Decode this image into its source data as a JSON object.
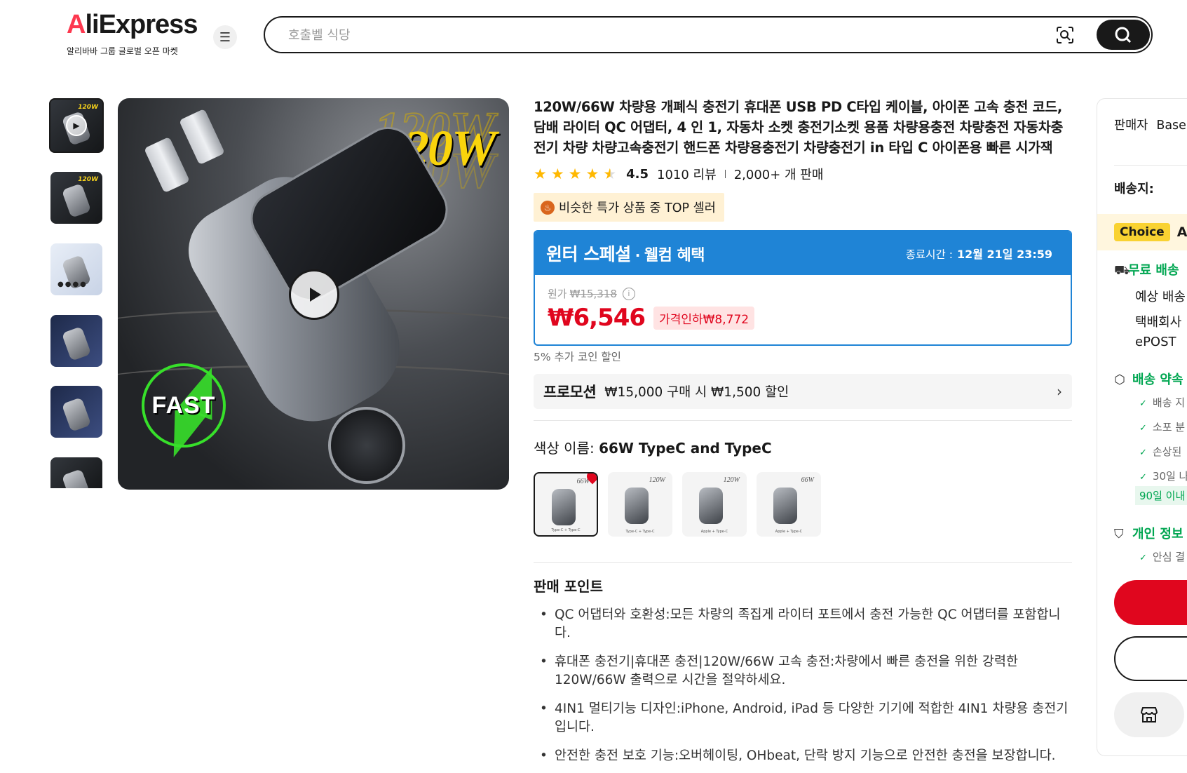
{
  "header": {
    "logo_prefix": "A",
    "logo_rest": "liExpress",
    "logo_sub": "알리바바 그룹 글로벌 오픈 마켓",
    "menu_icon": "hamburger-icon",
    "search_placeholder": "호출벨 식당",
    "scan_icon": "image-search-icon",
    "search_icon": "search-icon"
  },
  "gallery": {
    "main_wattage": "120W",
    "main_fast": "FAST",
    "thumb_labels": [
      "120W",
      "120W"
    ]
  },
  "product": {
    "title": "120W/66W 차량용 개폐식 충전기 휴대폰 USB PD C타입 케이블, 아이폰 고속 충전 코드, 담배 라이터 QC 어댑터, 4 인 1, 자동차 소켓 충전기소켓 용품 차량용충전 차량충전 자동차충전기 차량 차량고속충전기 핸드폰 차량용충전기 차량충전기 in 타입 C 아이폰용 빠른 시가잭",
    "rating": "4.5",
    "rating_value": 4.5,
    "reviews": "1010 리뷰",
    "sold": "2,000+ 개 판매",
    "top_badge": "비슷한 특가 상품 중 TOP 셀러"
  },
  "promo": {
    "title_main": "윈터 스페셜",
    "title_dot": "·",
    "title_sub": "웰컴 혜택",
    "end_label": "종료시간 :",
    "end_time": "12월 21일 23:59",
    "orig_label": "원가",
    "orig_price": "₩15,318",
    "price": "₩6,546",
    "discount": "가격인하₩8,772",
    "coin_note": "5% 추가 코인 할인",
    "strip_label": "프로모션",
    "strip_text": "₩15,000 구매 시 ₩1,500 할인"
  },
  "variants": {
    "label": "색상 이름:",
    "selected": "66W TypeC and TypeC",
    "items": [
      {
        "cap": "66W",
        "foot": "Type-C + Type-C"
      },
      {
        "cap": "120W",
        "foot": "Type-C + Type-C"
      },
      {
        "cap": "120W",
        "foot": "Apple + Type-C"
      },
      {
        "cap": "66W",
        "foot": "Apple + Type-C"
      }
    ]
  },
  "selling_points": {
    "title": "판매 포인트",
    "items": [
      "QC 어댑터와 호환성:모든 차량의 족집게 라이터 포트에서 충전 가능한 QC 어댑터를 포함합니다.",
      "휴대폰 충전기|휴대폰 충전|120W/66W 고속 충전:차량에서 빠른 충전을 위한 강력한 120W/66W 출력으로 시간을 절약하세요.",
      "4IN1 멀티기능 디자인:iPhone, Android, iPad 등 다양한 기기에 적합한 4IN1 차량용 충전기입니다.",
      "안전한 충전 보호 기능:오버헤이팅, OHbeat, 단락 방지 기능으로 안전한 충전을 보장합니다."
    ]
  },
  "right_panel": {
    "seller_label": "판매자",
    "seller_name": "Base",
    "ship_to": "배송지:",
    "choice": "Choice",
    "choice_after": "Ali",
    "free_ship": "무료 배송",
    "est": "예상 배송",
    "courier": "택배회사",
    "epost": "ePOST",
    "promise": "배송 약속",
    "checks": [
      "배송 지",
      "소포 분",
      "손상된",
      "30일 나"
    ],
    "ninety": "90일 이내",
    "privacy": "개인 정보",
    "safe": "안심 결"
  }
}
